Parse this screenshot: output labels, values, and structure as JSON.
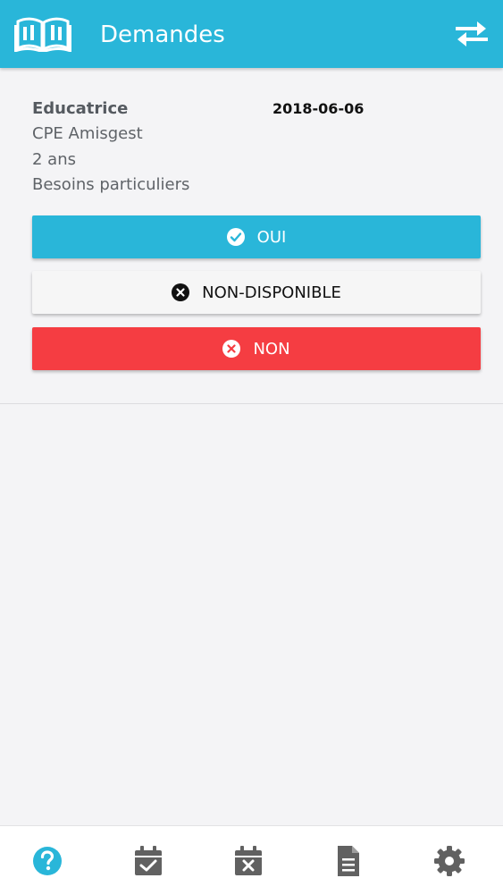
{
  "header": {
    "title": "Demandes",
    "logo_icon": "book-icon",
    "swap_icon": "swap-arrows-icon"
  },
  "request": {
    "role": "Educatrice",
    "date": "2018-06-06",
    "organization": "CPE Amisgest",
    "age": "2 ans",
    "note": "Besoins particuliers"
  },
  "actions": {
    "yes_label": "OUI",
    "unavailable_label": "NON-DISPONIBLE",
    "no_label": "NON"
  },
  "tabbar": {
    "items": [
      {
        "icon": "question-circle-icon",
        "active": true
      },
      {
        "icon": "calendar-check-icon",
        "active": false
      },
      {
        "icon": "calendar-x-icon",
        "active": false
      },
      {
        "icon": "document-icon",
        "active": false
      },
      {
        "icon": "gear-icon",
        "active": false
      }
    ]
  },
  "colors": {
    "primary": "#29b6d9",
    "danger": "#f53d42",
    "neutral_button": "#f6f6f6",
    "icon_gray": "#616161",
    "background": "#f4f4f6"
  }
}
